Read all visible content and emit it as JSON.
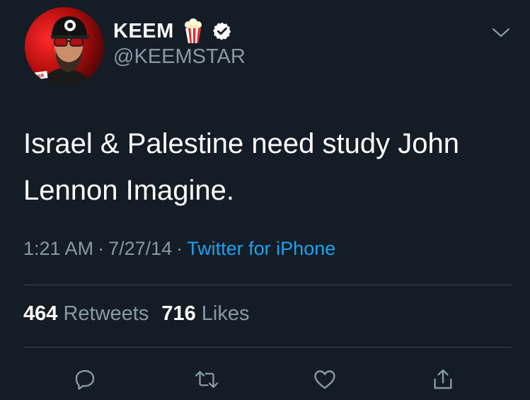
{
  "author": {
    "display_name": "KEEM",
    "emoji": "popcorn-icon",
    "verified": true,
    "handle": "@KEEMSTAR",
    "avatar_badge_text": "STAR"
  },
  "tweet": {
    "text_line_1": "Israel & Palestine need study John",
    "text_line_2": "Lennon Imagine."
  },
  "meta": {
    "time": "1:21 AM",
    "separator": "·",
    "date": "7/27/14",
    "source": "Twitter for iPhone"
  },
  "stats": {
    "retweets_count": "464",
    "retweets_label": "Retweets",
    "likes_count": "716",
    "likes_label": "Likes"
  },
  "actions": {
    "reply": "reply-icon",
    "retweet": "retweet-icon",
    "like": "heart-icon",
    "share": "share-icon"
  },
  "colors": {
    "background": "#141d26",
    "secondary_text": "#8899a6",
    "link": "#1da1f2",
    "divider": "#38444d"
  }
}
